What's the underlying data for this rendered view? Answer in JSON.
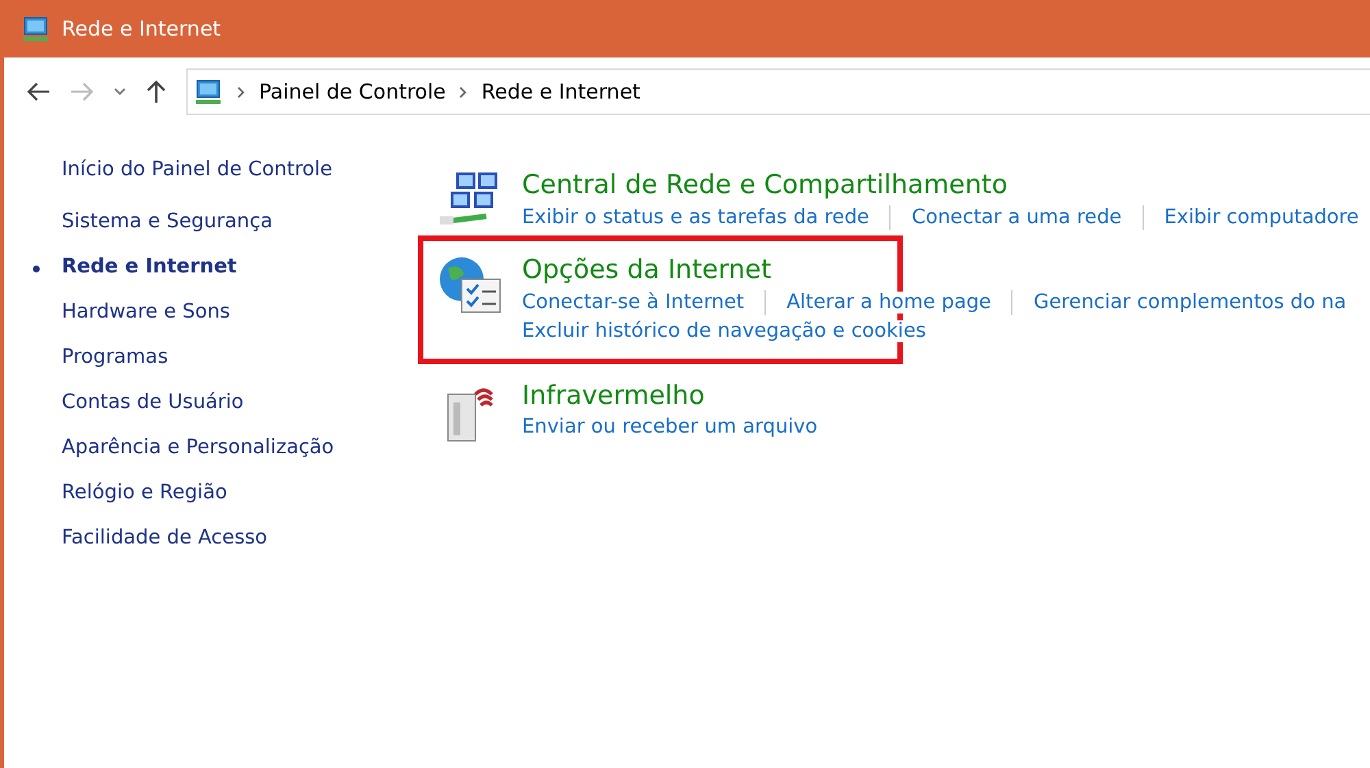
{
  "window": {
    "title": "Rede e Internet"
  },
  "address_bar": {
    "breadcrumbs": [
      "Painel de Controle",
      "Rede e Internet"
    ]
  },
  "sidebar": {
    "home_link": "Início do Painel de Controle",
    "items": [
      {
        "label": "Sistema e Segurança",
        "selected": false
      },
      {
        "label": "Rede e Internet",
        "selected": true
      },
      {
        "label": "Hardware e Sons",
        "selected": false
      },
      {
        "label": "Programas",
        "selected": false
      },
      {
        "label": "Contas de Usuário",
        "selected": false
      },
      {
        "label": "Aparência e Personalização",
        "selected": false
      },
      {
        "label": "Relógio e Região",
        "selected": false
      },
      {
        "label": "Facilidade de Acesso",
        "selected": false
      }
    ]
  },
  "categories": [
    {
      "kind": "network",
      "title": "Central de Rede e Compartilhamento",
      "highlighted": false,
      "link_rows": [
        [
          "Exibir o status e as tarefas da rede",
          "Conectar a uma rede",
          "Exibir computadore"
        ]
      ]
    },
    {
      "kind": "internet",
      "title": "Opções da Internet",
      "highlighted": true,
      "link_rows": [
        [
          "Conectar-se à Internet",
          "Alterar a home page",
          "Gerenciar complementos do na"
        ],
        [
          "Excluir histórico de navegação e cookies"
        ]
      ]
    },
    {
      "kind": "infrared",
      "title": "Infravermelho",
      "highlighted": false,
      "link_rows": [
        [
          "Enviar ou receber um arquivo"
        ]
      ]
    }
  ]
}
